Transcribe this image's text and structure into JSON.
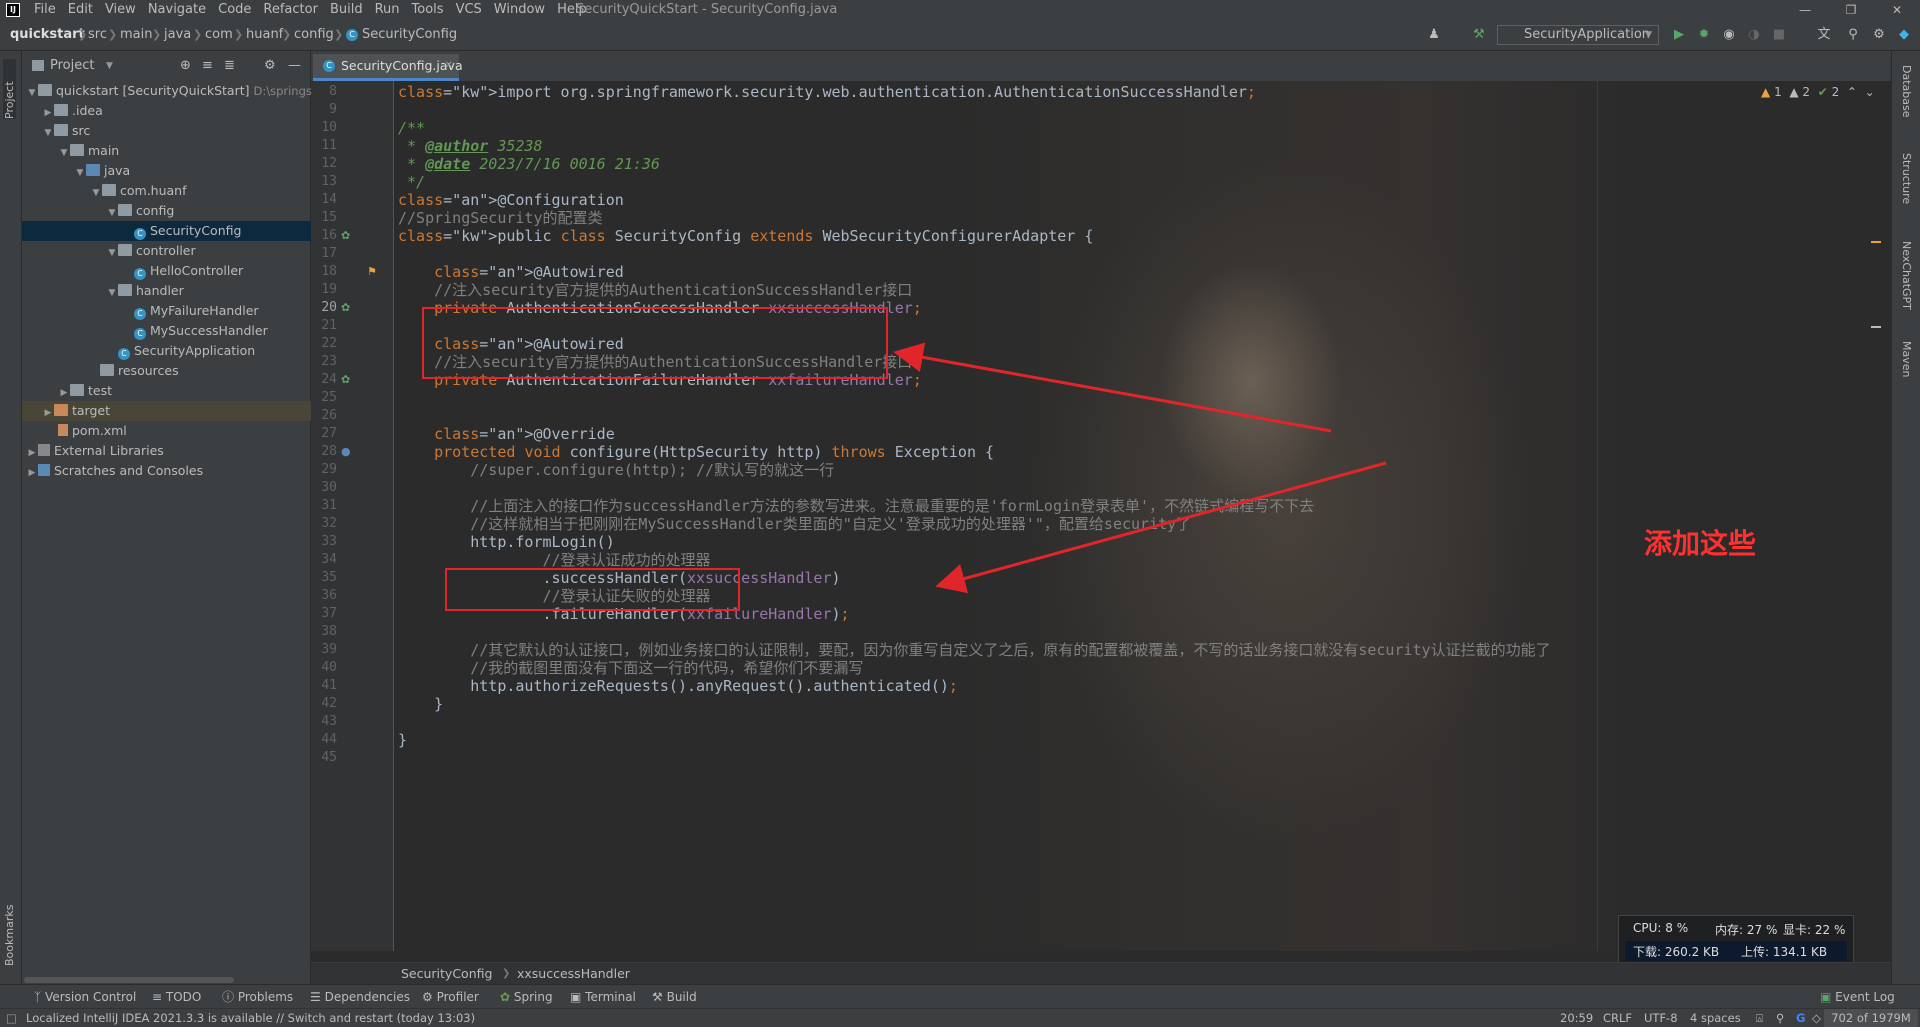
{
  "app": {
    "menu": [
      "File",
      "Edit",
      "View",
      "Navigate",
      "Code",
      "Refactor",
      "Build",
      "Run",
      "Tools",
      "VCS",
      "Window",
      "Help"
    ],
    "window_title": "SecurityQuickStart - SecurityConfig.java"
  },
  "navbar": {
    "crumbs": [
      "quickstart",
      "src",
      "main",
      "java",
      "com",
      "huanf",
      "config",
      "SecurityConfig"
    ],
    "run_config": "SecurityApplication"
  },
  "left_stripe": {
    "project_tab": "Project",
    "bookmarks_tab": "Bookmarks"
  },
  "project": {
    "header": "Project",
    "tree": [
      {
        "label": "quickstart [SecurityQuickStart]",
        "extra": "D:\\springs"
      },
      {
        "label": ".idea"
      },
      {
        "label": "src"
      },
      {
        "label": "main"
      },
      {
        "label": "java"
      },
      {
        "label": "com.huanf"
      },
      {
        "label": "config"
      },
      {
        "label": "SecurityConfig"
      },
      {
        "label": "controller"
      },
      {
        "label": "HelloController"
      },
      {
        "label": "handler"
      },
      {
        "label": "MyFailureHandler"
      },
      {
        "label": "MySuccessHandler"
      },
      {
        "label": "SecurityApplication"
      },
      {
        "label": "resources"
      },
      {
        "label": "test"
      },
      {
        "label": "target"
      },
      {
        "label": "pom.xml"
      },
      {
        "label": "External Libraries"
      },
      {
        "label": "Scratches and Consoles"
      }
    ]
  },
  "editor": {
    "tab": "SecurityConfig.java",
    "inspections": {
      "warn": "1",
      "weak": "2",
      "typo": "2"
    },
    "annotation": "添加这些",
    "lines": [
      {
        "n": "8",
        "html": "import org.springframework.security.web.authentication.AuthenticationSuccessHandler;"
      },
      {
        "n": "9",
        "html": ""
      },
      {
        "n": "10",
        "html": "/**"
      },
      {
        "n": "11",
        "html": " * @author 35238"
      },
      {
        "n": "12",
        "html": " * @date 2023/7/16 0016 21:36"
      },
      {
        "n": "13",
        "html": " */"
      },
      {
        "n": "14",
        "html": "@Configuration"
      },
      {
        "n": "15",
        "html": "//SpringSecurity的配置类"
      },
      {
        "n": "16",
        "html": "public class SecurityConfig extends WebSecurityConfigurerAdapter {"
      },
      {
        "n": "17",
        "html": ""
      },
      {
        "n": "18",
        "html": "    @Autowired"
      },
      {
        "n": "19",
        "html": "    //注入security官方提供的AuthenticationSuccessHandler接口"
      },
      {
        "n": "20",
        "html": "    private AuthenticationSuccessHandler xxsuccessHandler;"
      },
      {
        "n": "21",
        "html": ""
      },
      {
        "n": "22",
        "html": "    @Autowired"
      },
      {
        "n": "23",
        "html": "    //注入security官方提供的AuthenticationSuccessHandler接口"
      },
      {
        "n": "24",
        "html": "    private AuthenticationFailureHandler xxfailureHandler;"
      },
      {
        "n": "25",
        "html": ""
      },
      {
        "n": "26",
        "html": ""
      },
      {
        "n": "27",
        "html": "    @Override"
      },
      {
        "n": "28",
        "html": "    protected void configure(HttpSecurity http) throws Exception {"
      },
      {
        "n": "29",
        "html": "        //super.configure(http); //默认写的就这一行"
      },
      {
        "n": "30",
        "html": ""
      },
      {
        "n": "31",
        "html": "        //上面注入的接口作为successHandler方法的参数写进来。注意最重要的是'formLogin登录表单'，不然链式编程写不下去"
      },
      {
        "n": "32",
        "html": "        //这样就相当于把刚刚在MySuccessHandler类里面的\"自定义'登录成功的处理器'\"，配置给security了"
      },
      {
        "n": "33",
        "html": "        http.formLogin()"
      },
      {
        "n": "34",
        "html": "                //登录认证成功的处理器"
      },
      {
        "n": "35",
        "html": "                .successHandler(xxsuccessHandler)"
      },
      {
        "n": "36",
        "html": "                //登录认证失败的处理器"
      },
      {
        "n": "37",
        "html": "                .failureHandler(xxfailureHandler);"
      },
      {
        "n": "38",
        "html": ""
      },
      {
        "n": "39",
        "html": "        //其它默认的认证接口，例如业务接口的认证限制，要配，因为你重写自定义了之后，原有的配置都被覆盖，不写的话业务接口就没有security认证拦截的功能了"
      },
      {
        "n": "40",
        "html": "        //我的截图里面没有下面这一行的代码，希望你们不要漏写"
      },
      {
        "n": "41",
        "html": "        http.authorizeRequests().anyRequest().authenticated();"
      },
      {
        "n": "42",
        "html": "    }"
      },
      {
        "n": "43",
        "html": ""
      },
      {
        "n": "44",
        "html": "}"
      },
      {
        "n": "45",
        "html": ""
      }
    ],
    "crumbs": [
      "SecurityConfig",
      "xxsuccessHandler"
    ]
  },
  "right_stripe": [
    "Database",
    "Structure",
    "NexChatGPT",
    "Maven"
  ],
  "perf": {
    "cpu": "CPU: 8 %",
    "mem": "内存: 27 %",
    "gpu": "显卡: 22 %",
    "down": "下载: 260.2 KB",
    "up": "上传: 134.1 KB"
  },
  "bottom_tools": [
    "Version Control",
    "TODO",
    "Problems",
    "Dependencies",
    "Profiler",
    "Spring",
    "Terminal",
    "Build",
    "Event Log"
  ],
  "status": {
    "message": "Localized IntelliJ IDEA 2021.3.3 is available // Switch and restart (today 13:03)",
    "position": "20:59",
    "line_sep": "CRLF",
    "encoding": "UTF-8",
    "indent": "4 spaces",
    "memory": "702 of 1979M"
  }
}
